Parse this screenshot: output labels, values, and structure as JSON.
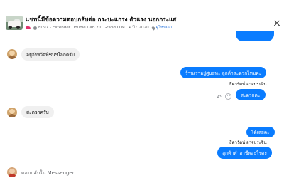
{
  "header": {
    "title": "แชทนี้มีข้อความตอบกลับต่อ กระบะแกร่ง ตัวแรง นอกกระแส",
    "listing": "E097 - Extender Double Cab 2.0 Grand D MT",
    "year": "ปี : 2020",
    "location_link": "ดูโซษณา",
    "separator": "•"
  },
  "messages": {
    "m1": "อยู่จังหวัดพี่ชนฯโลกครับ",
    "m2": "ร้านเราอยู่ศูนยพะ ลูกค้าสะดวกไหมคะ",
    "m2_name": "ธีดารัตน์ อาจประจิน",
    "m3": "สะดวกคะ",
    "m4": "สะดวกครับ",
    "m5": "ได้เลยคะ",
    "m5_name": "ธีดารัตน์ อาจประจิน",
    "m6": "ลูกค้าทำอาชีพอะไรคะ"
  },
  "composer": {
    "placeholder": "ตอบกลับใน Messenger..."
  },
  "colors": {
    "accent": "#0a7cff",
    "bubble_grey": "#f0f0f0",
    "link": "#216fdb"
  }
}
